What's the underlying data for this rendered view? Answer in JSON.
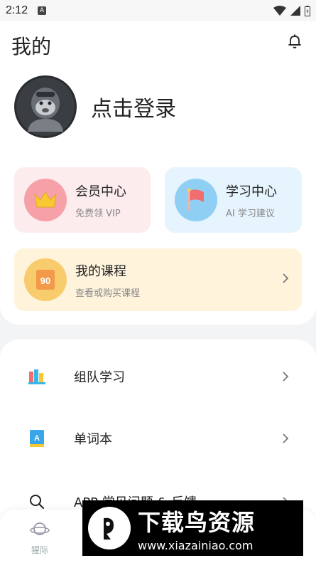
{
  "status_bar": {
    "time": "2:12",
    "notif_icon": "A"
  },
  "header": {
    "title": "我的"
  },
  "profile": {
    "login_label": "点击登录"
  },
  "tiles": {
    "vip": {
      "title": "会员中心",
      "subtitle": "免费领 VIP"
    },
    "study": {
      "title": "学习中心",
      "subtitle": "AI 学习建议"
    },
    "course": {
      "title": "我的课程",
      "subtitle": "查看或购买课程",
      "badge": "90"
    }
  },
  "list": {
    "items": [
      {
        "label": "组队学习",
        "icon": "books-icon"
      },
      {
        "label": "单词本",
        "icon": "wordbook-icon"
      },
      {
        "label": "APP 常见问题 & 反馈",
        "icon": "search-icon"
      }
    ]
  },
  "bottom_nav": {
    "items": [
      {
        "label": "猩际"
      }
    ]
  },
  "watermark": {
    "brand": "下载鸟资源",
    "url": "www.xiazainiao.com"
  },
  "colors": {
    "vip_bg": "#fdecee",
    "study_bg": "#e6f4fe",
    "course_bg": "#fff3dc"
  }
}
